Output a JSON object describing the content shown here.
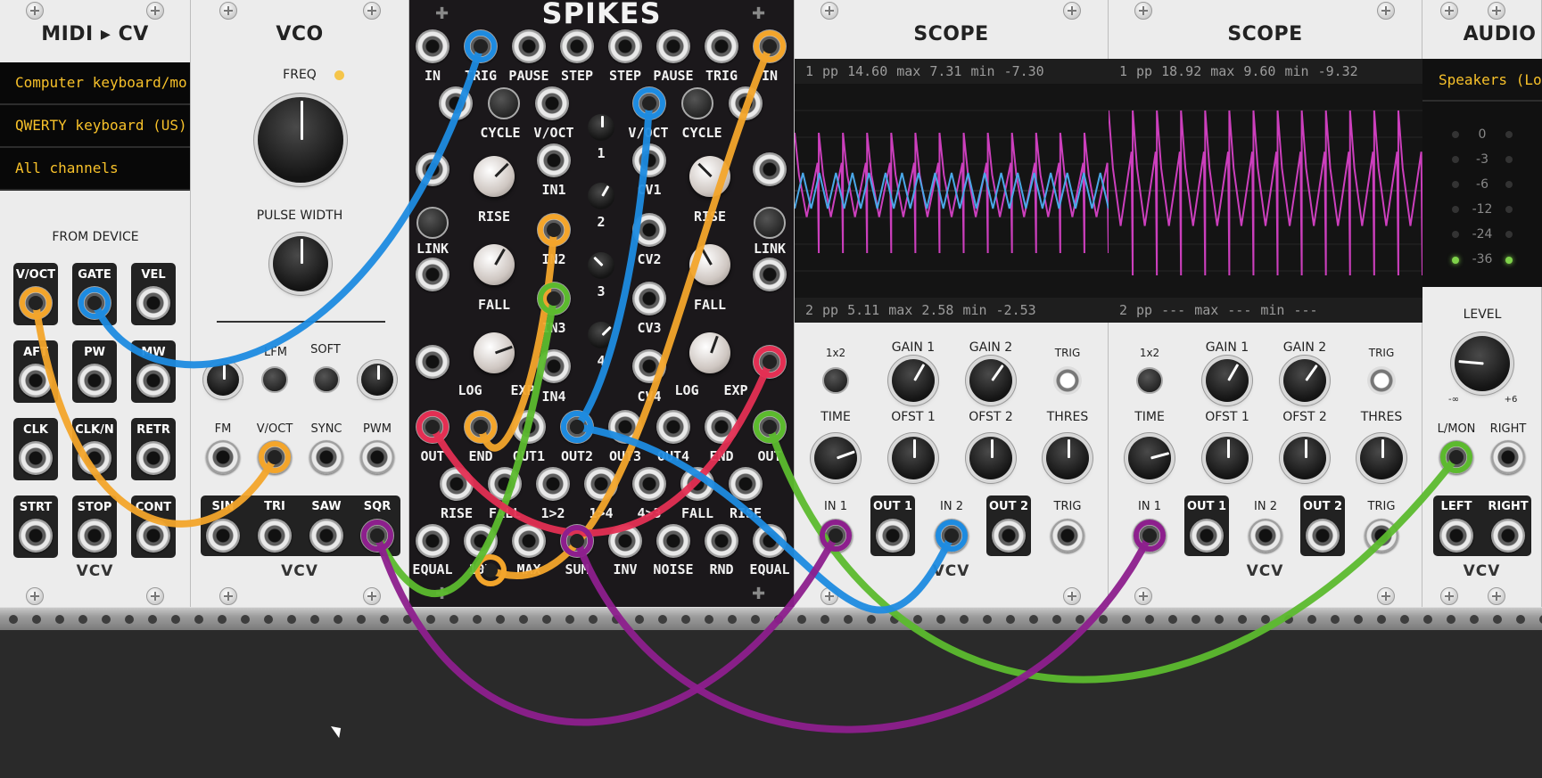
{
  "midi_cv": {
    "title": "MIDI ▸ CV",
    "device_driver": "Computer keyboard/mo",
    "device": "QWERTY keyboard (US)",
    "channel": "All channels",
    "section_label": "FROM DEVICE",
    "outputs": [
      "V/OCT",
      "GATE",
      "VEL",
      "AFT",
      "PW",
      "MW",
      "CLK",
      "CLK/N",
      "RETR",
      "STRT",
      "STOP",
      "CONT"
    ],
    "brand": "VCV"
  },
  "vco": {
    "title": "VCO",
    "freq_label": "FREQ",
    "pulse_width_label": "PULSE WIDTH",
    "switch_labels": [
      "LFM",
      "SOFT"
    ],
    "input_labels": [
      "FM",
      "V/OCT",
      "SYNC",
      "PWM"
    ],
    "output_labels": [
      "SIN",
      "TRI",
      "SAW",
      "SQR"
    ],
    "brand": "VCV"
  },
  "spikes": {
    "title": "SPIKES",
    "top_jacks": [
      "IN",
      "TRIG",
      "PAUSE",
      "STEP",
      "STEP",
      "PAUSE",
      "TRIG",
      "IN"
    ],
    "row2_labels": [
      "CYCLE",
      "V/OCT",
      "V/OCT",
      "CYCLE"
    ],
    "mid_labels": [
      "RISE",
      "IN1",
      "RISE",
      "LINK",
      "IN2",
      "LINK",
      "FALL",
      "IN3",
      "FALL",
      "LOG",
      "EXP",
      "IN4",
      "LOG",
      "EXP"
    ],
    "cv_labels": [
      "CV1",
      "CV2",
      "CV3",
      "CV4"
    ],
    "step_numbers": [
      "1",
      "2",
      "3",
      "4"
    ],
    "out_labels": [
      "OUT",
      "END",
      "OUT1",
      "OUT2",
      "OUT3",
      "OUT4",
      "END",
      "OUT"
    ],
    "bottom_row1": [
      "RISE",
      "FALL",
      "1>2",
      "1>4",
      "4>3",
      "FALL",
      "RISE"
    ],
    "bottom_row2": [
      "EQUAL",
      "10V",
      "MAX",
      "SUM",
      "INV",
      "NOISE",
      "RND",
      "EQUAL"
    ]
  },
  "scope1": {
    "title": "SCOPE",
    "ch1": {
      "num": "1",
      "pp": "14.60",
      "max": "7.31",
      "min": "-7.30"
    },
    "ch2": {
      "num": "2",
      "pp": "5.11",
      "max": "2.58",
      "min": "-2.53"
    },
    "knob_labels": [
      "1x2",
      "GAIN 1",
      "GAIN 2",
      "TRIG",
      "TIME",
      "OFST 1",
      "OFST 2",
      "THRES"
    ],
    "jack_labels": [
      "IN 1",
      "OUT 1",
      "IN 2",
      "OUT 2",
      "TRIG"
    ],
    "brand": "VCV",
    "trace1_color": "#cc3fbd",
    "trace2_color": "#4aa7e8"
  },
  "scope2": {
    "title": "SCOPE",
    "ch1": {
      "num": "1",
      "pp": "18.92",
      "max": "9.60",
      "min": "-9.32"
    },
    "ch2": {
      "num": "2",
      "pp": "---",
      "max": "---",
      "min": "---"
    },
    "knob_labels": [
      "1x2",
      "GAIN 1",
      "GAIN 2",
      "TRIG",
      "TIME",
      "OFST 1",
      "OFST 2",
      "THRES"
    ],
    "jack_labels": [
      "IN 1",
      "OUT 1",
      "IN 2",
      "OUT 2",
      "TRIG"
    ],
    "brand": "VCV"
  },
  "audio": {
    "title": "AUDIO",
    "device": "Speakers (Lo",
    "meter_db": [
      "0",
      "-3",
      "-6",
      "-12",
      "-24",
      "-36"
    ],
    "level_label": "LEVEL",
    "level_min": "-∞",
    "level_max": "+6",
    "input_labels": [
      "L/MON",
      "RIGHT"
    ],
    "output_labels": [
      "LEFT",
      "RIGHT"
    ],
    "brand": "VCV"
  },
  "cable_colors": {
    "blue": "#1e8be0",
    "orange": "#f3a52b",
    "green": "#5cba2e",
    "magenta": "#8d1f8d",
    "red": "#e32f53"
  }
}
